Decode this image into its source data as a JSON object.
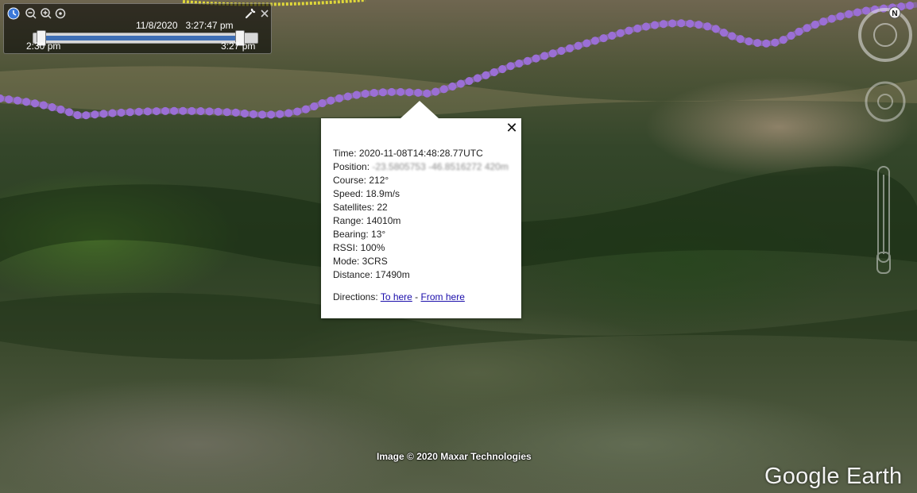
{
  "map": {
    "credit": "Image © 2020 Maxar Technologies",
    "logo": "Google Earth",
    "track_color": "#9b6fd6",
    "secondary_track_color": "#e0d83a"
  },
  "time_control": {
    "date": "11/8/2020",
    "time": "3:27:47 pm",
    "range_start": "2:30 pm",
    "range_end": "3:27 pm",
    "icons": [
      "clock-icon",
      "zoom-out-icon",
      "zoom-in-icon",
      "timeline-settings-icon",
      "wrench-icon",
      "close-icon"
    ]
  },
  "balloon": {
    "time_label": "Time: ",
    "time_value": "2020-11-08T14:48:28.77UTC",
    "position_label": "Position: ",
    "position_value": "-23.5805753 -46.8516272 420m",
    "course": "Course: 212°",
    "speed": "Speed: 18.9m/s",
    "satellites": "Satellites: 22",
    "range": "Range: 14010m",
    "bearing": "Bearing: 13°",
    "rssi": "RSSI: 100%",
    "mode": "Mode: 3CRS",
    "distance": "Distance: 17490m",
    "directions_label": "Directions: ",
    "to_here": "To here",
    "separator": " - ",
    "from_here": "From here",
    "close_symbol": "✕"
  },
  "nav": {
    "compass_north": "N"
  }
}
